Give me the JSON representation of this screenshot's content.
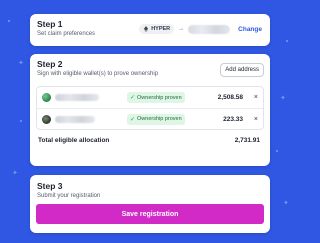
{
  "colors": {
    "background": "#2f57e3",
    "accent_link": "#2f57e3",
    "primary_button": "#d12ac6",
    "proven_badge_bg": "#dff5e6",
    "proven_badge_text": "#1f6b3a"
  },
  "step1": {
    "title": "Step 1",
    "subtitle": "Set claim preferences",
    "token_label": "HYPER",
    "token_icon": "ethereum-diamond-icon",
    "arrow": "→",
    "change_label": "Change"
  },
  "step2": {
    "title": "Step 2",
    "subtitle": "Sign with eligible wallet(s) to prove ownership",
    "add_address_label": "Add address",
    "wallets": [
      {
        "status": "Ownership proven",
        "amount": "2,508.58",
        "remove": "×",
        "avatar_color": "#3c8f5a"
      },
      {
        "status": "Ownership proven",
        "amount": "223.33",
        "remove": "×",
        "avatar_color": "#2d3b2f"
      }
    ],
    "total_label": "Total eligible allocation",
    "total_value": "2,731.91"
  },
  "step3": {
    "title": "Step 3",
    "subtitle": "Submit your registration",
    "save_label": "Save registration"
  }
}
